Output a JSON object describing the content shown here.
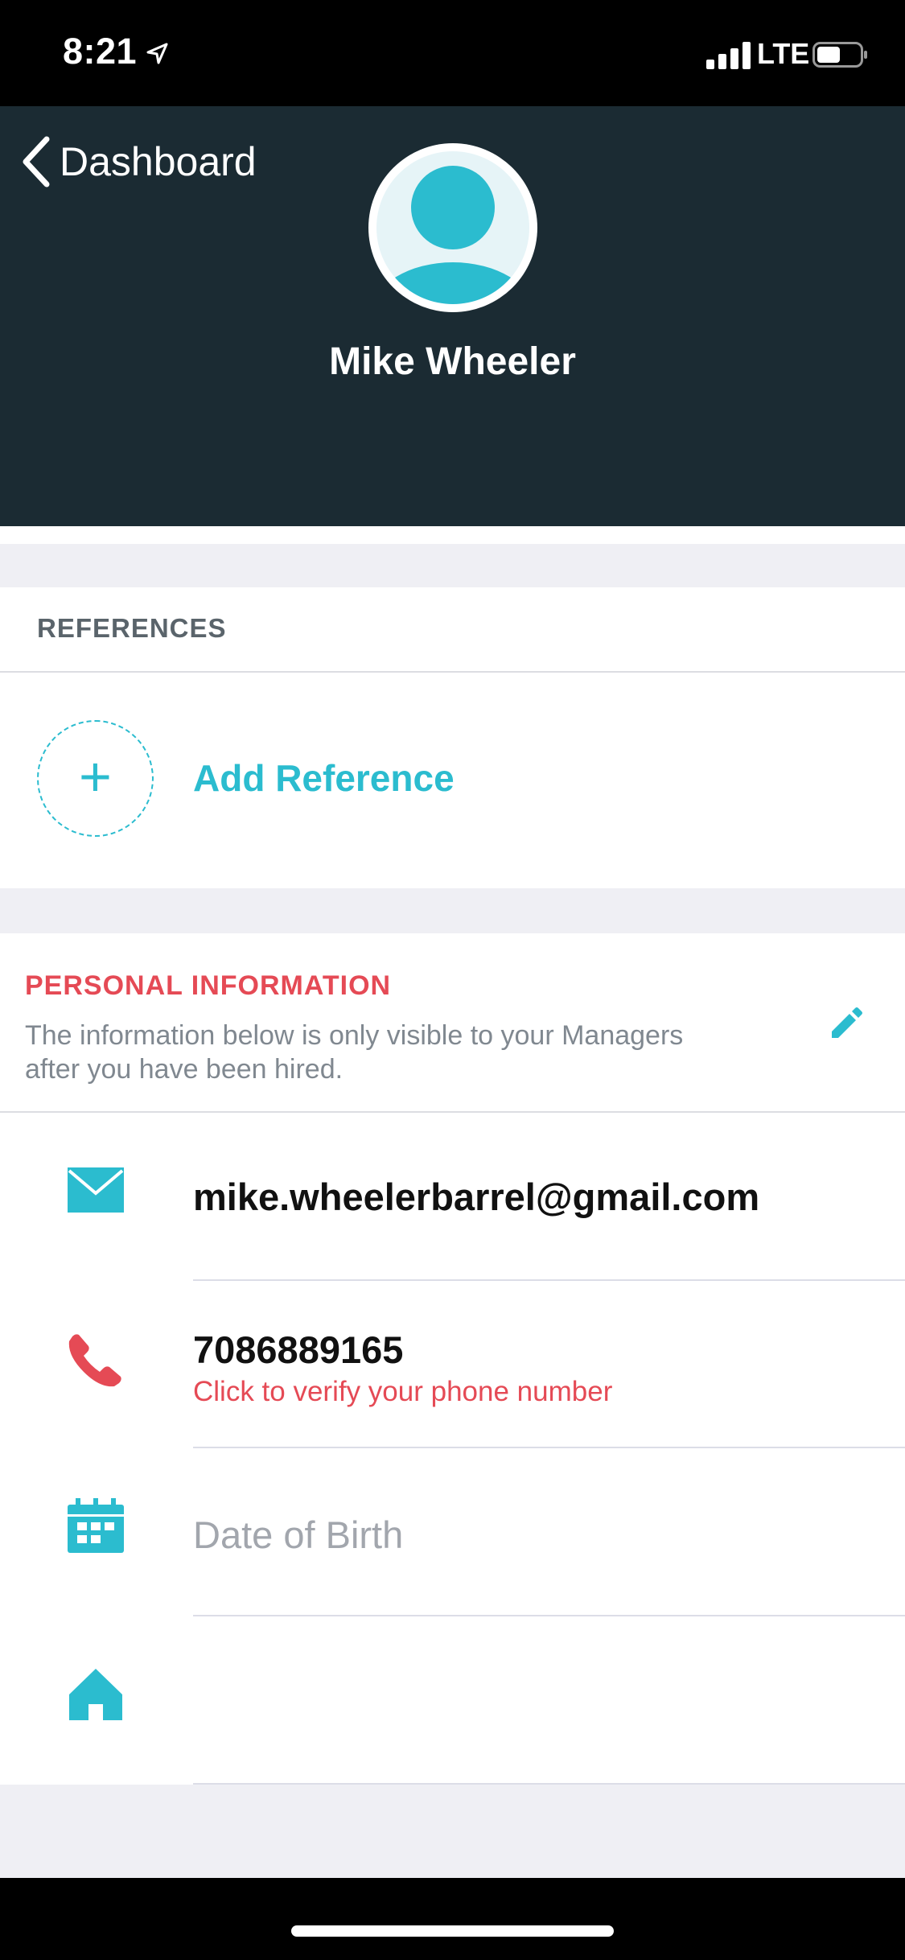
{
  "status_bar": {
    "time": "8:21",
    "network": "LTE"
  },
  "header": {
    "back_label": "Dashboard",
    "user_name": "Mike Wheeler"
  },
  "references": {
    "title": "REFERENCES",
    "add_label": "Add Reference"
  },
  "personal_info": {
    "title": "PERSONAL INFORMATION",
    "description": "The information below is only visible to your Managers after you have been hired.",
    "email": "mike.wheelerbarrel@gmail.com",
    "phone": "7086889165",
    "phone_verify": "Click to verify your phone number",
    "dob_placeholder": "Date of Birth",
    "address": ""
  },
  "colors": {
    "accent": "#2bbccf",
    "alert": "#e54a55",
    "header_bg": "#1b2b33"
  },
  "icons": [
    "location-arrow-icon",
    "signal-icon",
    "battery-icon",
    "back-chevron-icon",
    "avatar-icon",
    "plus-icon",
    "edit-pencil-icon",
    "mail-icon",
    "phone-icon",
    "calendar-icon",
    "home-icon"
  ]
}
